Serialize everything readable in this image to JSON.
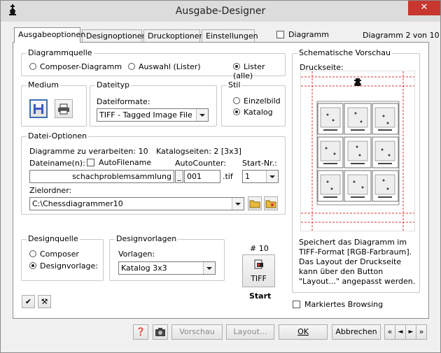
{
  "window": {
    "title": "Ausgabe-Designer",
    "close_glyph": "✕"
  },
  "tabs": [
    {
      "label": "Ausgabeoptionen",
      "active": true
    },
    {
      "label": "Designoptionen"
    },
    {
      "label": "Druckoptionen"
    },
    {
      "label": "Einstellungen"
    }
  ],
  "header": {
    "diagramm_label": "Diagramm",
    "diagramm_counter": "Diagramm 2 von 10"
  },
  "diagrammquelle": {
    "legend": "Diagrammquelle",
    "options": [
      "Composer-Diagramm",
      "Auswahl (Lister)",
      "Lister (alle)"
    ],
    "selected": "Lister (alle)"
  },
  "medium": {
    "legend": "Medium",
    "save_icon": "floppy-disk-icon",
    "print_icon": "printer-icon"
  },
  "dateityp": {
    "legend": "Dateityp",
    "label": "Dateiformate:",
    "value": "TIFF - Tagged Image File"
  },
  "stil": {
    "legend": "Stil",
    "options": [
      "Einzelbild",
      "Katalog"
    ],
    "selected": "Katalog"
  },
  "datei_optionen": {
    "legend": "Datei-Optionen",
    "zu_verarbeiten": "Diagramme zu verarbeiten: 10",
    "katalogseiten": "Katalogseiten:  2 [3x3]",
    "dateiname_label": "Dateiname(n):",
    "autofilename_label": "AutoFilename",
    "autocounter_label": "AutoCounter:",
    "startnr_label": "Start-Nr.:",
    "dateiname_value": "schachproblemsammlung",
    "sep_glyph": "_",
    "autocounter_value": "001",
    "ext": ".tif",
    "startnr_value": "1",
    "zielordner_label": "Zielordner:",
    "zielordner_value": "C:\\Chessdiagrammer10"
  },
  "designquelle": {
    "legend": "Designquelle",
    "options": [
      "Composer",
      "Designvorlage:"
    ],
    "selected": "Designvorlage:"
  },
  "designvorlagen": {
    "legend": "Designvorlagen",
    "label": "Vorlagen:",
    "value": "Katalog 3x3"
  },
  "start": {
    "count": "# 10",
    "label": "TIFF",
    "caption": "Start"
  },
  "vorschau": {
    "legend": "Schematische Vorschau",
    "druckseite": "Druckseite:",
    "description": "Speichert das Diagramm im TIFF-Format [RGB-Farbraum]. Das Layout der Druckseite kann über den Button \"Layout...\" angepasst werden."
  },
  "markiertes_browsing": "Markiertes Browsing",
  "bottom": {
    "vorschau": "Vorschau",
    "layout": "Layout...",
    "ok": "OK",
    "abbrechen": "Abbrechen",
    "nav": [
      "«",
      "◄",
      "►",
      "»"
    ]
  },
  "colors": {
    "accent_red": "#d33",
    "close_red": "#c7372f",
    "panel_bg": "#ffffff",
    "window_bg": "#f0f0f0"
  }
}
